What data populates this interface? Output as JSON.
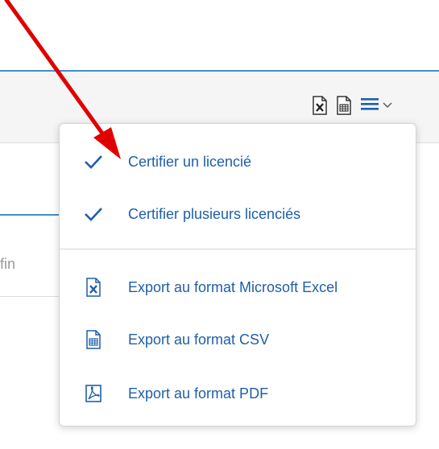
{
  "background": {
    "field_text": "fin"
  },
  "toolbar": {
    "icons": [
      "excel-icon",
      "csv-icon",
      "hamburger-menu-icon",
      "chevron-down-icon"
    ]
  },
  "menu": {
    "items": [
      {
        "label": "Certifier un licencié",
        "icon": "checkmark-icon"
      },
      {
        "label": "Certifier plusieurs licenciés",
        "icon": "checkmark-icon"
      },
      {
        "label": "Export au format Microsoft Excel",
        "icon": "excel-icon"
      },
      {
        "label": "Export au format CSV",
        "icon": "csv-icon"
      },
      {
        "label": "Export au format PDF",
        "icon": "pdf-icon"
      }
    ]
  },
  "colors": {
    "accent_blue": "#1f5fa8",
    "rule_blue": "#3f8fd0",
    "annotation_arrow": "#e00000"
  }
}
